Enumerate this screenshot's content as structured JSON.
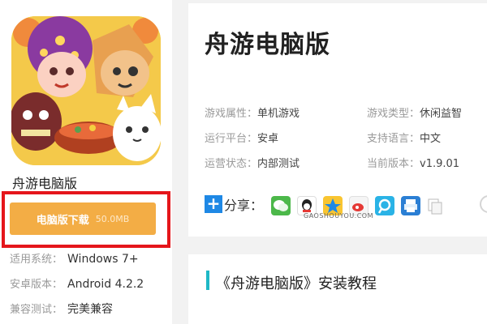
{
  "app": {
    "name": "舟游电脑版",
    "download": {
      "label": "电脑版下载",
      "size": "50.0MB",
      "accent": "#f3ad45",
      "highlight": "#e5161b"
    },
    "specs": [
      {
        "key": "适用系统：",
        "value": "Windows 7+"
      },
      {
        "key": "安卓版本：",
        "value": "Android 4.2.2"
      },
      {
        "key": "兼容测试：",
        "value": "完美兼容"
      }
    ]
  },
  "detail": {
    "title": "舟游电脑版",
    "attrs": [
      {
        "key": "游戏属性：",
        "value": "单机游戏"
      },
      {
        "key": "游戏类型：",
        "value": "休闲益智"
      },
      {
        "key": "运行平台：",
        "value": "安卓"
      },
      {
        "key": "支持语言：",
        "value": "中文"
      },
      {
        "key": "运营状态：",
        "value": "内部测试"
      },
      {
        "key": "当前版本：",
        "value": "v1.9.01"
      }
    ],
    "share": {
      "label": "分享：",
      "icons": [
        "wechat-icon",
        "qq-icon",
        "qzone-icon",
        "weibo-icon",
        "tencent-weibo-icon",
        "print-icon",
        "copy-icon"
      ]
    },
    "watermark": "GAOSHOUYOU.COM"
  },
  "tutorial": {
    "title": "《舟游电脑版》安装教程",
    "accent": "#1fb8c6"
  }
}
